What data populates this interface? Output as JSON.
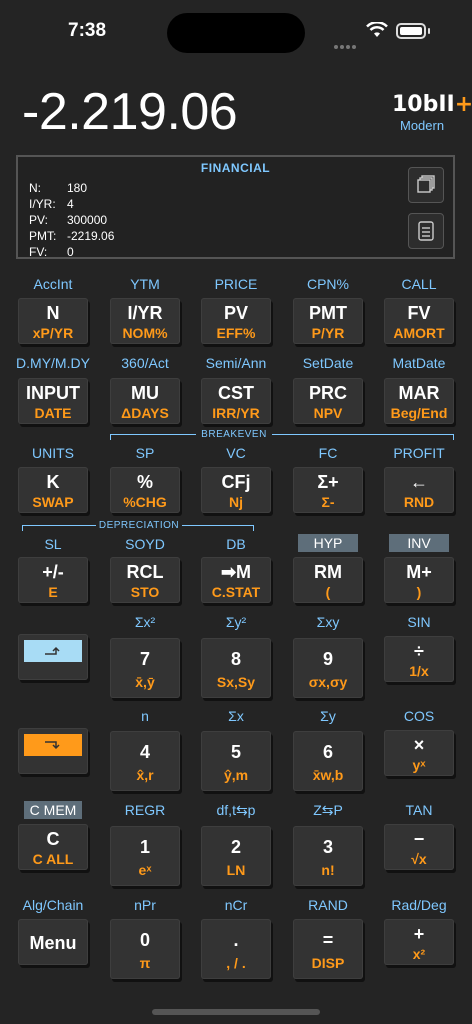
{
  "status": {
    "time": "7:38"
  },
  "display": {
    "value": "-2.219.06",
    "logo_main": "10bII",
    "logo_plus": "+",
    "logo_sub": "Modern"
  },
  "panel": {
    "title": "FINANCIAL",
    "rows": [
      {
        "label": "N:",
        "value": "180"
      },
      {
        "label": "I/YR:",
        "value": "4"
      },
      {
        "label": "PV:",
        "value": "300000"
      },
      {
        "label": "PMT:",
        "value": "-2219.06"
      },
      {
        "label": "FV:",
        "value": "0"
      }
    ]
  },
  "rows": [
    {
      "labels": [
        "AccInt",
        "YTM",
        "PRICE",
        "CPN%",
        "CALL"
      ],
      "keys": [
        {
          "p": "N",
          "s": "xP/YR"
        },
        {
          "p": "I/YR",
          "s": "NOM%"
        },
        {
          "p": "PV",
          "s": "EFF%"
        },
        {
          "p": "PMT",
          "s": "P/YR"
        },
        {
          "p": "FV",
          "s": "AMORT"
        }
      ]
    },
    {
      "labels": [
        "D.MY/M.DY",
        "360/Act",
        "Semi/Ann",
        "SetDate",
        "MatDate"
      ],
      "keys": [
        {
          "p": "INPUT",
          "s": "DATE"
        },
        {
          "p": "MU",
          "s": "ΔDAYS"
        },
        {
          "p": "CST",
          "s": "IRR/YR"
        },
        {
          "p": "PRC",
          "s": "NPV"
        },
        {
          "p": "MAR",
          "s": "Beg/End"
        }
      ]
    },
    {
      "labels": [
        "UNITS",
        "SP",
        "VC",
        "FC",
        "PROFIT"
      ],
      "keys": [
        {
          "p": "K",
          "s": "SWAP"
        },
        {
          "p": "%",
          "s": "%CHG"
        },
        {
          "p": "CFj",
          "s": "Nj"
        },
        {
          "p": "Σ+",
          "s": "Σ-"
        },
        {
          "p": "←",
          "s": "RND"
        }
      ]
    },
    {
      "labels": [
        "SL",
        "SOYD",
        "DB",
        "HYP",
        "INV"
      ],
      "keys": [
        {
          "p": "+/-",
          "s": "E"
        },
        {
          "p": "RCL",
          "s": "STO"
        },
        {
          "p": "➡M",
          "s": "C.STAT"
        },
        {
          "p": "RM",
          "s": "("
        },
        {
          "p": "M+",
          "s": ")"
        }
      ]
    },
    {
      "labels": [
        "",
        "Σx²",
        "Σy²",
        "Σxy",
        "SIN"
      ],
      "keys": [
        {
          "p": "",
          "s": ""
        },
        {
          "p": "7",
          "s": "x̄,ȳ"
        },
        {
          "p": "8",
          "s": "Sx,Sy"
        },
        {
          "p": "9",
          "s": "σx,σy"
        },
        {
          "p": "÷",
          "s": "1/x"
        }
      ]
    },
    {
      "labels": [
        "",
        "n",
        "Σx",
        "Σy",
        "COS"
      ],
      "keys": [
        {
          "p": "",
          "s": ""
        },
        {
          "p": "4",
          "s": "x̂,r"
        },
        {
          "p": "5",
          "s": "ŷ,m"
        },
        {
          "p": "6",
          "s": "x̄w,b"
        },
        {
          "p": "×",
          "s": "yˣ"
        }
      ]
    },
    {
      "labels": [
        "C MEM",
        "REGR",
        "df,t⇆p",
        "Z⇆P",
        "TAN"
      ],
      "keys": [
        {
          "p": "C",
          "s": "C ALL"
        },
        {
          "p": "1",
          "s": "eˣ"
        },
        {
          "p": "2",
          "s": "LN"
        },
        {
          "p": "3",
          "s": "n!"
        },
        {
          "p": "−",
          "s": "√x"
        }
      ]
    },
    {
      "labels": [
        "Alg/Chain",
        "nPr",
        "nCr",
        "RAND",
        "Rad/Deg"
      ],
      "keys": [
        {
          "p": "Menu",
          "s": ""
        },
        {
          "p": "0",
          "s": "π"
        },
        {
          "p": ".",
          "s": ", / ."
        },
        {
          "p": "=",
          "s": "DISP"
        },
        {
          "p": "+",
          "s": "x²"
        }
      ]
    }
  ],
  "groups": {
    "breakeven": "BREAKEVEN",
    "depreciation": "DEPRECIATION"
  },
  "colors": {
    "accent_orange": "#ff9a1a",
    "label_blue": "#7fc8ff",
    "shift_blue": "#a8dcf5",
    "shift_orange": "#ff9a1a"
  }
}
